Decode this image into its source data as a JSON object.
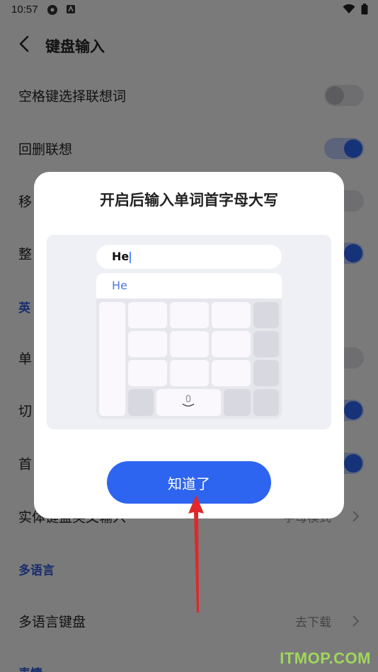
{
  "status": {
    "time": "10:57"
  },
  "header": {
    "title": "键盘输入"
  },
  "settings": {
    "row_space_assoc": "空格键选择联想词",
    "row_backspace_assoc": "回删联想",
    "row_move_partial": "移",
    "row_whole_partial": "整",
    "section_english_partial": "英",
    "row_single_partial": "单",
    "row_switch_partial": "切",
    "row_first_partial": "首",
    "row_physical": {
      "label": "实体键盘英文输入",
      "value": "字母模式"
    },
    "section_multilang": "多语言",
    "row_multilang_keyboard": {
      "label": "多语言键盘",
      "value": "去下载"
    },
    "section_emoji_partial": "表情"
  },
  "toggles": {
    "space_assoc": false,
    "backspace_assoc": true,
    "move": false,
    "whole": true,
    "single": false,
    "switch": true,
    "first": true
  },
  "dialog": {
    "title": "开启后输入单词首字母大写",
    "preview_input": "He",
    "preview_candidate": "He",
    "ok_label": "知道了"
  },
  "watermark": "ITMOP.COM",
  "colors": {
    "accent": "#2d64f0",
    "section": "#2f5bd6",
    "arrow": "#e0282a"
  }
}
